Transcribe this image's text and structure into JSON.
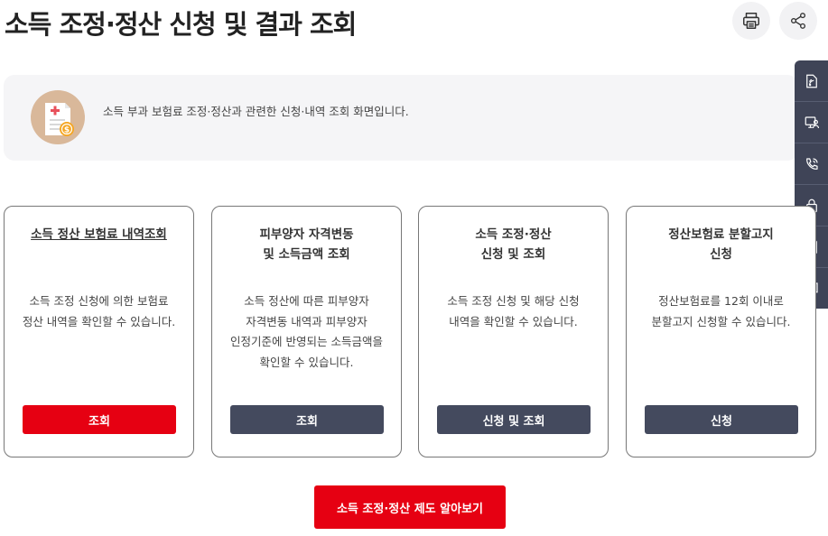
{
  "header": {
    "title": "소득 조정·정산 신청 및 결과 조회",
    "print_icon": "printer-icon",
    "share_icon": "share-icon"
  },
  "intro": {
    "icon": "document-coin-icon",
    "text": "소득 부과 보험료 조정·정산과 관련한 신청·내역 조회 화면입니다."
  },
  "side_menu": {
    "items": [
      {
        "icon": "document-signal-icon"
      },
      {
        "icon": "monitor-person-icon"
      },
      {
        "icon": "phone-call-icon"
      },
      {
        "icon": "lock-icon"
      },
      {
        "icon": "document-list-icon"
      },
      {
        "icon": "copy-pages-icon"
      }
    ]
  },
  "cards": [
    {
      "title": "소득 정산 보험료 내역조회",
      "description": "소득 조정 신청에 의한 보험료\n정산 내역을 확인할 수 있습니다.",
      "button": "조회"
    },
    {
      "title": "피부양자 자격변동\n및 소득금액 조회",
      "description": "소득 정산에 따른 피부양자\n자격변동 내역과 피부양자\n인정기준에 반영되는 소득금액을\n확인할 수 있습니다.",
      "button": "조회"
    },
    {
      "title": "소득 조정·정산\n신청 및 조회",
      "description": "소득 조정 신청 및 해당 신청\n내역을 확인할 수 있습니다.",
      "button": "신청 및 조회"
    },
    {
      "title": "정산보험료 분할고지\n신청",
      "description": "정산보험료를 12회 이내로\n분할고지 신청할 수 있습니다.",
      "button": "신청"
    }
  ],
  "bottom_button": "소득 조정·정산 제도 알아보기",
  "colors": {
    "accent_red": "#e60012",
    "dark_button": "#444a5e",
    "side_menu": "#3f4457"
  }
}
